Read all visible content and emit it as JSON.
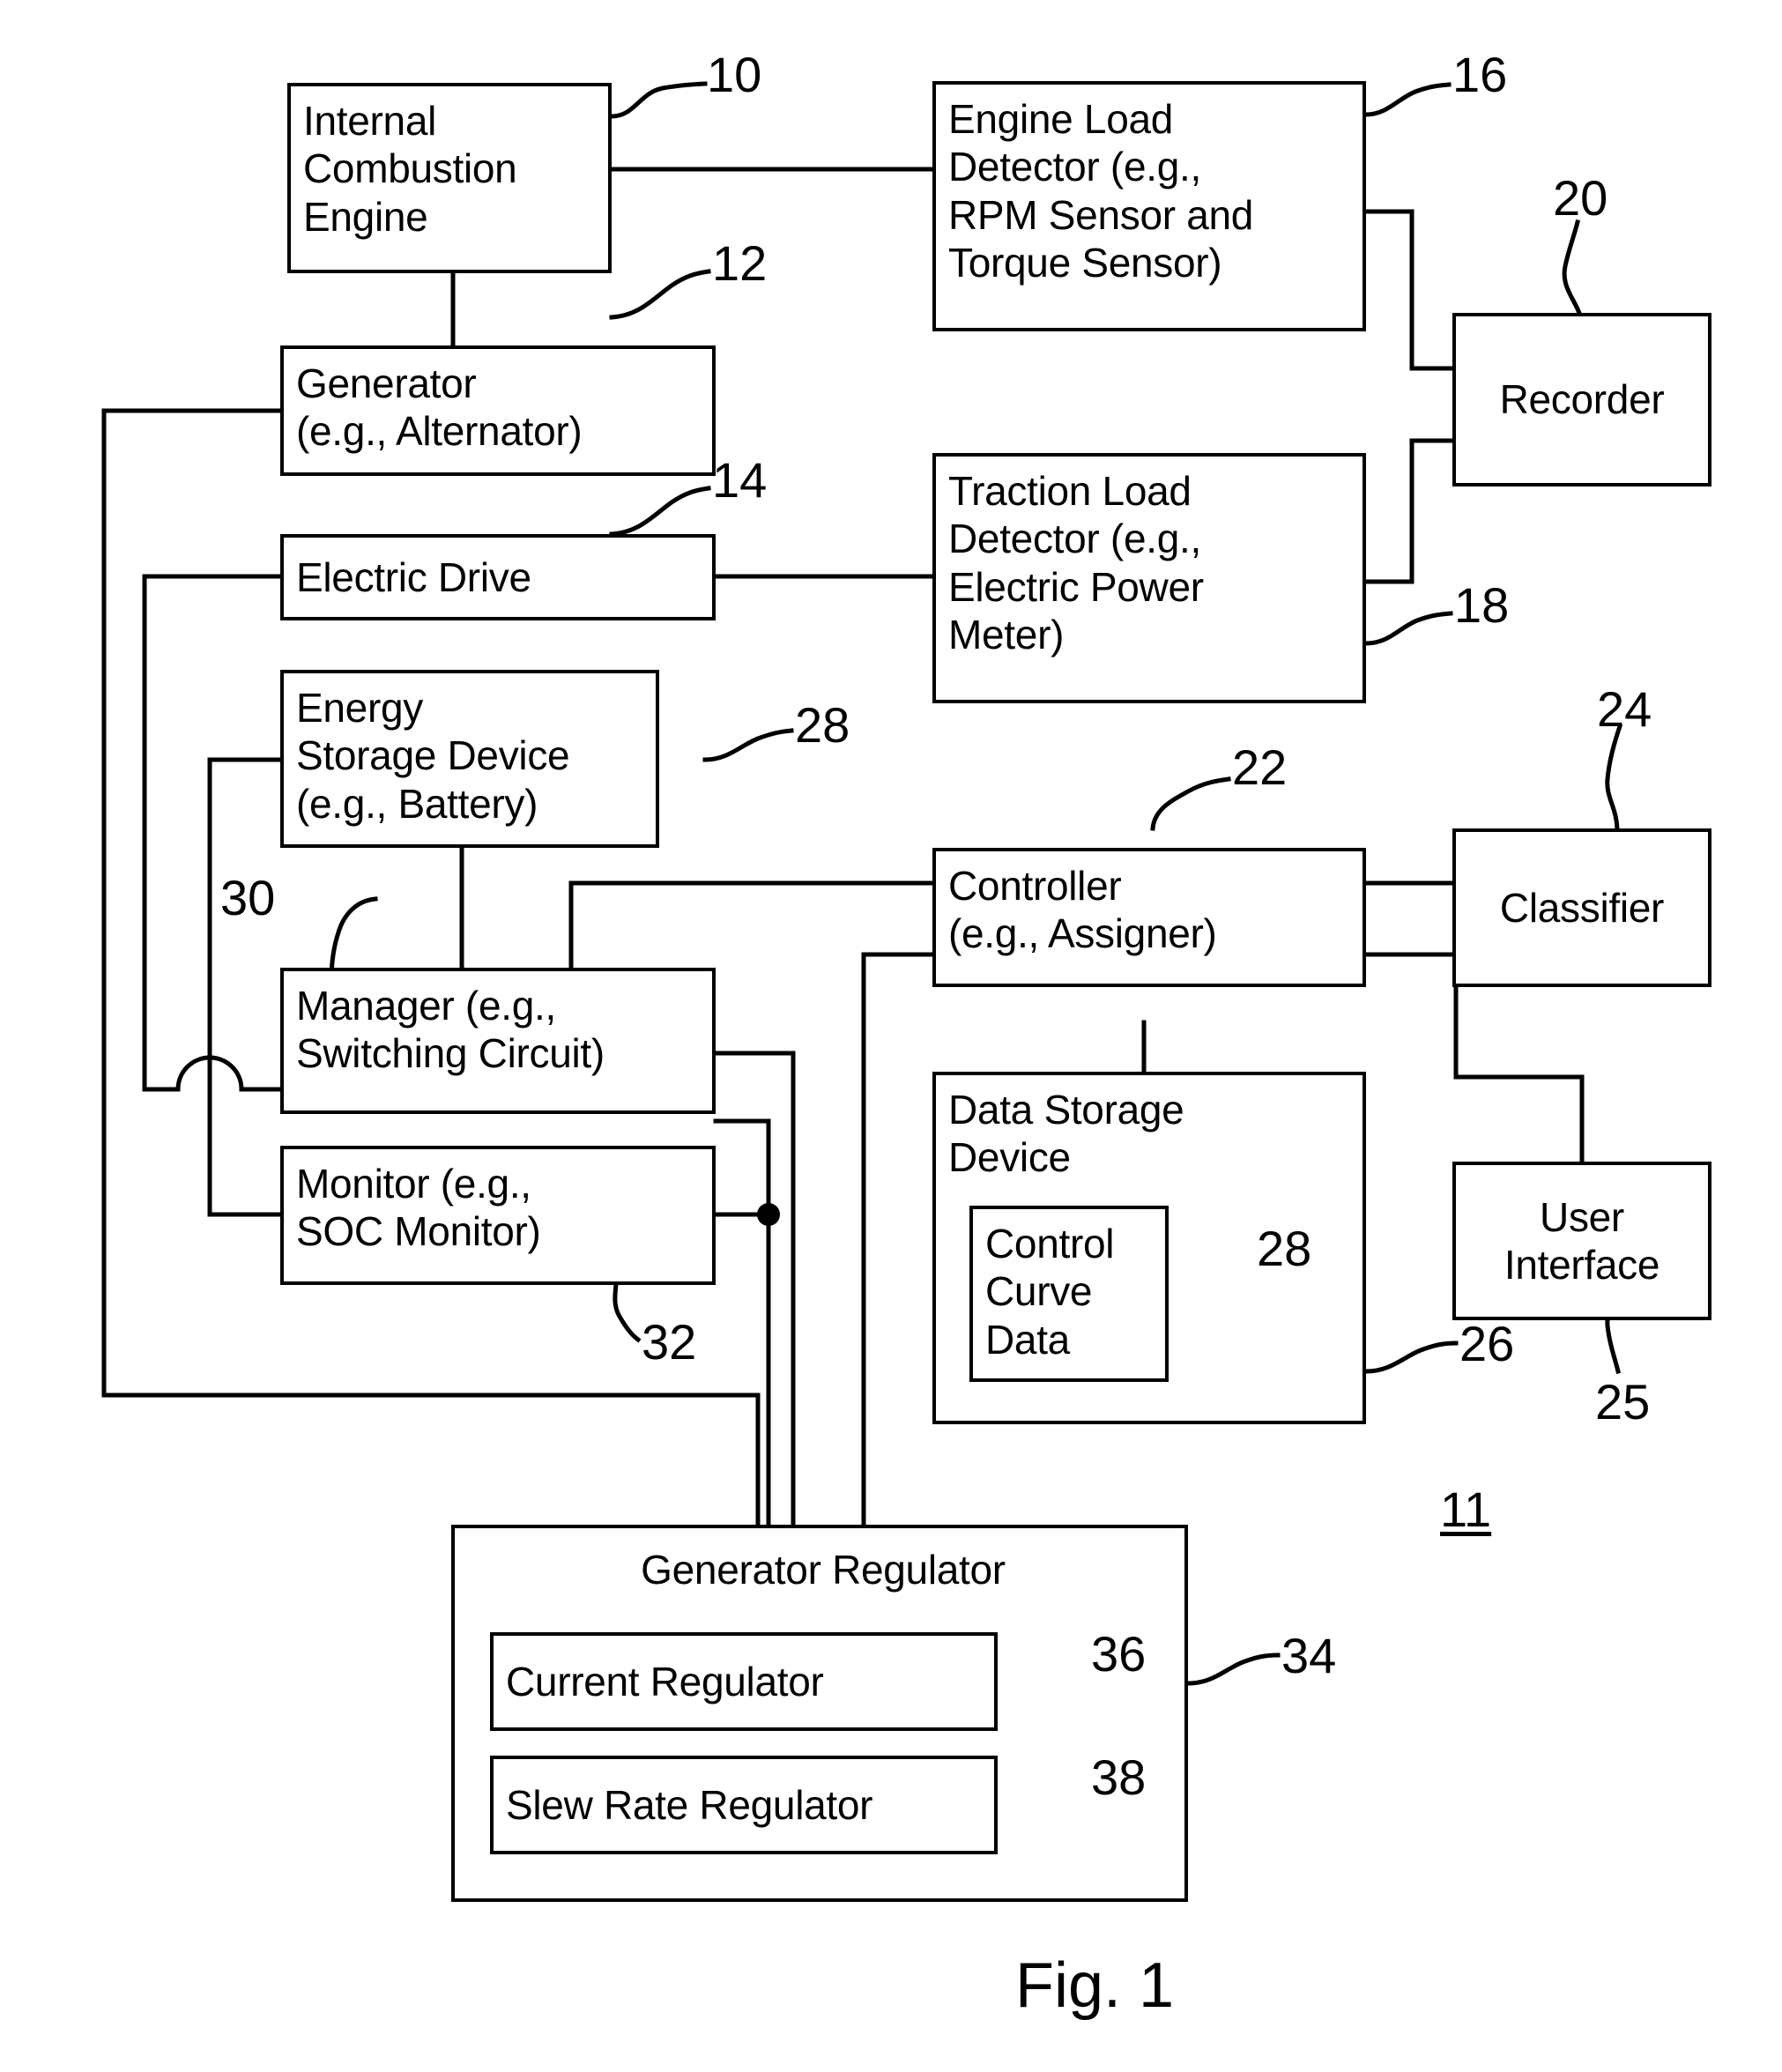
{
  "figure": {
    "caption": "Fig. 1",
    "system_ref": "11"
  },
  "blocks": [
    {
      "id": "internal-combustion-engine",
      "label": "Internal\nCombustion\nEngine",
      "ref": "10"
    },
    {
      "id": "engine-load-detector",
      "label": "Engine Load\nDetector (e.g.,\nRPM Sensor and\nTorque Sensor)",
      "ref": "16"
    },
    {
      "id": "recorder",
      "label": "Recorder",
      "ref": "20"
    },
    {
      "id": "generator",
      "label": "Generator\n(e.g., Alternator)",
      "ref": "12"
    },
    {
      "id": "electric-drive",
      "label": "Electric Drive",
      "ref": "14"
    },
    {
      "id": "traction-load-detector",
      "label": "Traction Load\nDetector (e.g.,\nElectric Power\nMeter)",
      "ref": "18"
    },
    {
      "id": "energy-storage-device",
      "label": "Energy\nStorage Device\n(e.g., Battery)",
      "ref": "28"
    },
    {
      "id": "controller",
      "label": "Controller\n(e.g., Assigner)",
      "ref": "22"
    },
    {
      "id": "classifier",
      "label": "Classifier",
      "ref": "24"
    },
    {
      "id": "manager",
      "label": "Manager (e.g.,\nSwitching Circuit)",
      "ref": "30"
    },
    {
      "id": "monitor",
      "label": "Monitor (e.g.,\nSOC Monitor)",
      "ref": "32"
    },
    {
      "id": "data-storage-device",
      "label": "Data Storage\nDevice",
      "ref": "26"
    },
    {
      "id": "control-curve-data",
      "label": "Control\nCurve\nData",
      "ref": "28"
    },
    {
      "id": "user-interface",
      "label": "User\nInterface",
      "ref": "25"
    },
    {
      "id": "generator-regulator",
      "label": "Generator Regulator",
      "ref": "34"
    },
    {
      "id": "current-regulator",
      "label": "Current Regulator",
      "ref": "36"
    },
    {
      "id": "slew-rate-regulator",
      "label": "Slew Rate Regulator",
      "ref": "38"
    }
  ],
  "colors": {
    "line": "#000000",
    "background": "#ffffff"
  }
}
